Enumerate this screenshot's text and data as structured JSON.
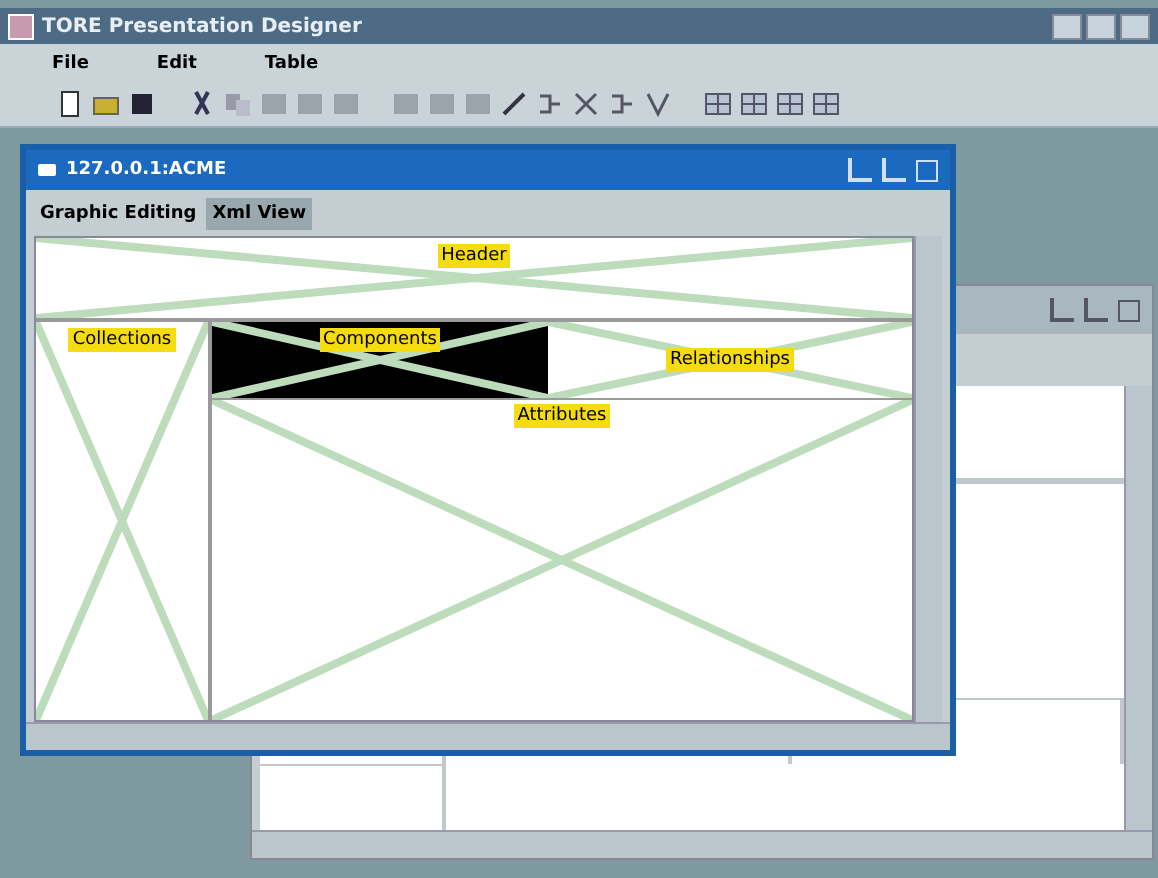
{
  "window": {
    "title": "TORE Presentation Designer"
  },
  "menu": [
    "File",
    "Edit",
    "Table"
  ],
  "inner_window": {
    "title": "127.0.0.1:ACME",
    "tabs": [
      {
        "label": "Graphic Editing",
        "selected": false
      },
      {
        "label": "Xml View",
        "selected": true
      }
    ],
    "regions": {
      "header": "Header",
      "collections": "Collections",
      "components": "Components",
      "relationships": "Relationships",
      "attributes": "Attributes"
    }
  }
}
